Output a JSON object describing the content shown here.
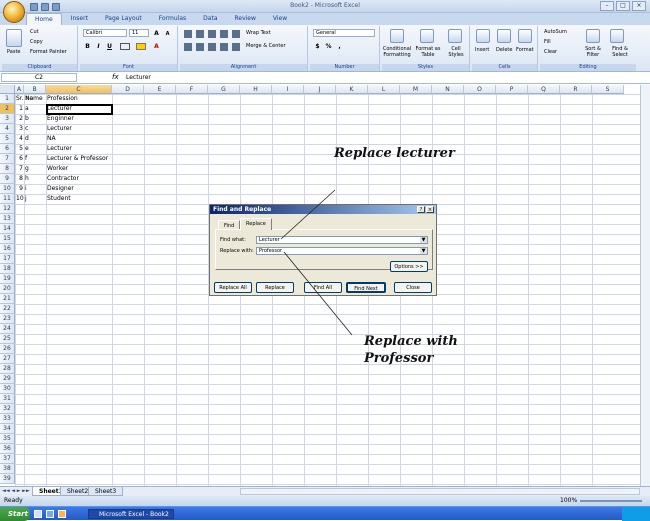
{
  "window": {
    "title": "Book2 - Microsoft Excel",
    "controls": [
      "–",
      "□",
      "×"
    ]
  },
  "ribbon_tabs": [
    "Home",
    "Insert",
    "Page Layout",
    "Formulas",
    "Data",
    "Review",
    "View"
  ],
  "ribbon": {
    "clipboard": {
      "label": "Clipboard",
      "paste": "Paste",
      "cut": "Cut",
      "copy": "Copy",
      "format_painter": "Format Painter"
    },
    "font": {
      "label": "Font",
      "name": "Calibri",
      "size": "11",
      "bold": "B",
      "italic": "I",
      "underline": "U"
    },
    "alignment": {
      "label": "Alignment",
      "wrap": "Wrap Text",
      "merge": "Merge & Center"
    },
    "number": {
      "label": "Number",
      "format": "General",
      "dollar": "$",
      "percent": "%",
      "comma": ","
    },
    "styles": {
      "label": "Styles",
      "conditional": "Conditional Formatting",
      "table": "Format as Table",
      "cell": "Cell Styles"
    },
    "cells": {
      "label": "Cells",
      "insert": "Insert",
      "delete": "Delete",
      "format": "Format"
    },
    "editing": {
      "label": "Editing",
      "autosum": "AutoSum",
      "fill": "Fill",
      "clear": "Clear",
      "sort": "Sort & Filter",
      "find": "Find & Select"
    }
  },
  "formula_bar": {
    "name_box": "C2",
    "fx": "fx",
    "value": "Lecturer"
  },
  "columns": [
    "A",
    "B",
    "C",
    "D",
    "E",
    "F",
    "G",
    "H",
    "I",
    "J",
    "K",
    "L",
    "M",
    "N",
    "O",
    "P",
    "Q",
    "R",
    "S"
  ],
  "rows": [
    "1",
    "2",
    "3",
    "4",
    "5",
    "6",
    "7",
    "8",
    "9",
    "10",
    "11",
    "12",
    "13",
    "14",
    "15",
    "16",
    "17",
    "18",
    "19",
    "20",
    "21",
    "22",
    "23",
    "24",
    "25",
    "26",
    "27",
    "28",
    "29",
    "30",
    "31",
    "32",
    "33",
    "34",
    "35",
    "36",
    "37",
    "38",
    "39"
  ],
  "table": {
    "headers": [
      "Sr. no",
      "Name",
      "Profession"
    ],
    "rows": [
      [
        "1",
        "a",
        "Lecturer"
      ],
      [
        "2",
        "b",
        "Enginner"
      ],
      [
        "3",
        "c",
        "Lecturer"
      ],
      [
        "4",
        "d",
        "NA"
      ],
      [
        "5",
        "e",
        "Lecturer"
      ],
      [
        "6",
        "f",
        "Lecturer & Professor"
      ],
      [
        "7",
        "g",
        "Worker"
      ],
      [
        "8",
        "h",
        "Contractor"
      ],
      [
        "9",
        "i",
        "Designer"
      ],
      [
        "10",
        "j",
        "Student"
      ]
    ]
  },
  "sheet_tabs": [
    "Sheet1",
    "Sheet2",
    "Sheet3"
  ],
  "status": {
    "text": "Ready",
    "zoom": "100%"
  },
  "taskbar": {
    "start": "Start",
    "item": "Microsoft Excel - Book2"
  },
  "dialog": {
    "title": "Find and Replace",
    "help": "?",
    "close": "×",
    "tabs": [
      "Find",
      "Replace"
    ],
    "find_label": "Find what:",
    "find_value": "Lecturer",
    "replace_label": "Replace with:",
    "replace_value": "Professor",
    "options": "Options >>",
    "buttons": [
      "Replace All",
      "Replace",
      "Find All",
      "Find Next",
      "Close"
    ]
  },
  "annotations": {
    "replace_lecturer": "Replace lecturer",
    "replace_with": "Replace with",
    "professor": "Professor"
  }
}
